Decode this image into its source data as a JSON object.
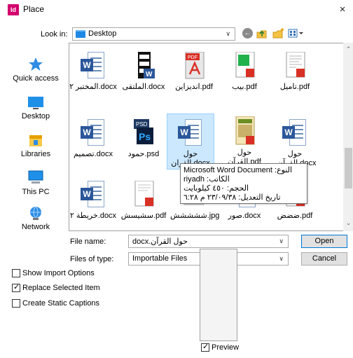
{
  "window": {
    "title": "Place",
    "app_icon": "Id",
    "close": "×"
  },
  "lookin": {
    "label": "Look in:",
    "value": "Desktop"
  },
  "toolbar": {
    "back_icon": "back-icon",
    "up_icon": "up-folder-icon",
    "new_folder_icon": "new-folder-icon",
    "views_icon": "views-menu-icon"
  },
  "places": [
    {
      "label": "Quick access",
      "icon": "star-icon"
    },
    {
      "label": "Desktop",
      "icon": "desktop-icon"
    },
    {
      "label": "Libraries",
      "icon": "libraries-icon"
    },
    {
      "label": "This PC",
      "icon": "computer-icon"
    },
    {
      "label": "Network",
      "icon": "network-icon"
    }
  ],
  "files": [
    {
      "name": "المختبر ٢.docx",
      "type": "word"
    },
    {
      "name": "الملتقى.docx",
      "type": "binder"
    },
    {
      "name": "انديزاين.pdf",
      "type": "pdf-red"
    },
    {
      "name": "بيب.pdf",
      "type": "pdf-green"
    },
    {
      "name": "تاميل.pdf",
      "type": "pdf-doc"
    },
    {
      "name": "تصميم.docx",
      "type": "word"
    },
    {
      "name": "حمود.psd",
      "type": "psd"
    },
    {
      "name": "حول القران.docx",
      "type": "word",
      "selected": true
    },
    {
      "name": "حول القرآن.pdf",
      "type": "pdf-book"
    },
    {
      "name": "حول القرآن.docx",
      "type": "word"
    },
    {
      "name": "خريطة ٢.docx",
      "type": "word"
    },
    {
      "name": "سشيسش.pdf",
      "type": "pdf-doc"
    },
    {
      "name": "ششششش.jpg",
      "type": "image"
    },
    {
      "name": "صور.docx",
      "type": "word"
    },
    {
      "name": "ضضض.pdf",
      "type": "pdf-red"
    }
  ],
  "tooltip": {
    "type": "النوع: Microsoft Word Document",
    "author": "الكاتب: riyadh",
    "size": "الحجم: ٤٥٠ كيلوبايت",
    "modified": "تاريخ التعديل: ٢٣/٠٩/٣٨ م ٦:٢٨"
  },
  "filename": {
    "label": "File name:",
    "value": "حول القرآن.docx"
  },
  "filetype": {
    "label": "Files of type:",
    "value": "Importable Files"
  },
  "buttons": {
    "open": "Open",
    "cancel": "Cancel"
  },
  "options": [
    {
      "label": "Show Import Options",
      "checked": false
    },
    {
      "label": "Replace Selected Item",
      "checked": true
    },
    {
      "label": "Create Static Captions",
      "checked": false
    }
  ],
  "preview": {
    "label": "Preview",
    "checked": true
  }
}
